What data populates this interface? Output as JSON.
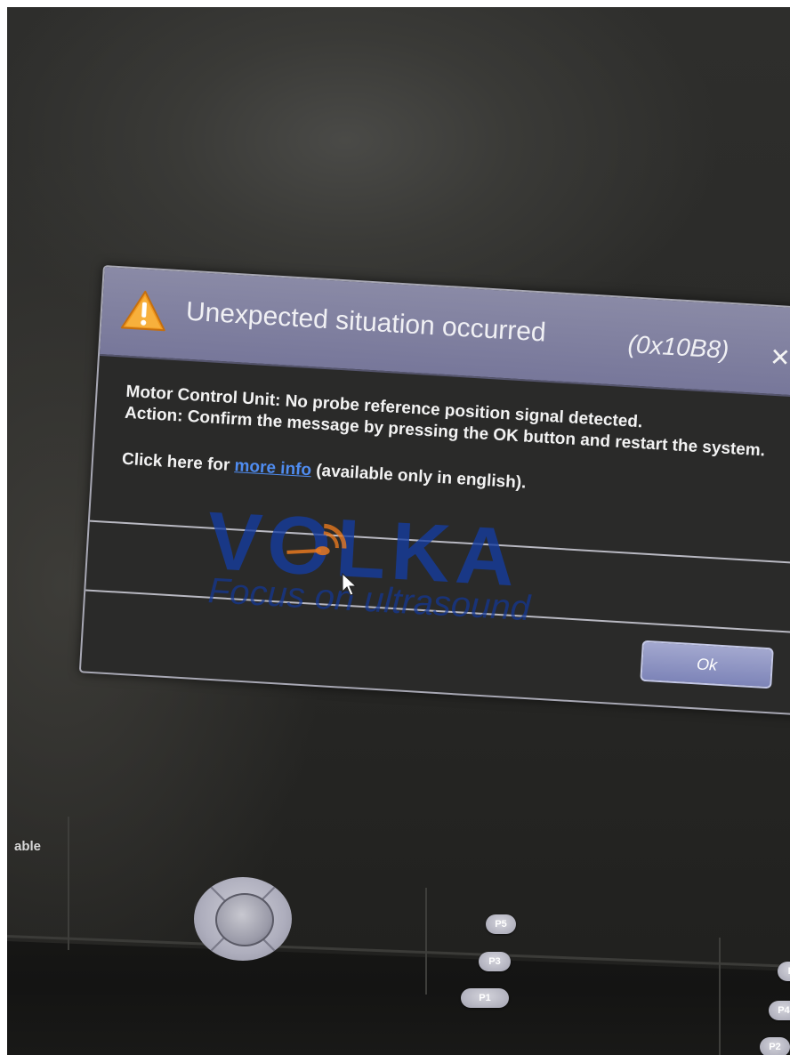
{
  "dialog": {
    "title": "Unexpected situation occurred",
    "code": "(0x10B8)",
    "close_glyph": "✕",
    "message_line1": "Motor Control Unit: No probe reference position signal detected.",
    "message_line2": "Action: Confirm the message by pressing the OK button and restart the system.",
    "info_prefix": "Click here for ",
    "info_link": "more info",
    "info_suffix": " (available only in english).",
    "ok_label": "Ok",
    "colors": {
      "title_bar": "#8080a0",
      "link": "#4f8cf0",
      "warning": "#f5a623"
    }
  },
  "watermark": {
    "brand": "VOLKA",
    "tagline": "Focus on ultrasound",
    "color": "#1a3c9c"
  },
  "console": {
    "side_label": "able",
    "buttons": [
      "P5",
      "P3",
      "P1",
      "F",
      "P4",
      "P2"
    ]
  },
  "icons": [
    "warning-icon",
    "close-icon",
    "mouse-cursor",
    "trackball"
  ]
}
